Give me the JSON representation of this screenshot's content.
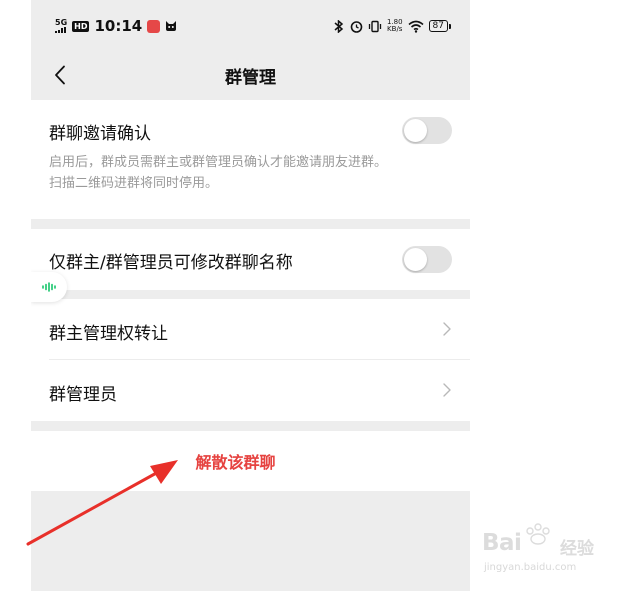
{
  "status_bar": {
    "network": "5G",
    "hd": "HD",
    "time": "10:14",
    "speed_value": "1.80",
    "speed_unit": "KB/s",
    "battery": "87"
  },
  "nav": {
    "title": "群管理"
  },
  "settings": {
    "invite_confirm": {
      "label": "群聊邀请确认",
      "description_line1": "启用后，群成员需群主或群管理员确认才能邀请朋友进群。",
      "description_line2": "扫描二维码进群将同时停用。",
      "enabled": false
    },
    "rename_restriction": {
      "label": "仅群主/群管理员可修改群聊名称",
      "enabled": false
    },
    "transfer_owner": {
      "label": "群主管理权转让"
    },
    "admins": {
      "label": "群管理员"
    },
    "dissolve": {
      "label": "解散该群聊"
    }
  },
  "colors": {
    "danger": "#e64340",
    "toggle_off": "#e2e2e2",
    "background": "#ededed",
    "arrow": "#e8302a"
  },
  "watermark": {
    "brand": "Bai",
    "brand_suffix": "经验",
    "url": "jingyan.baidu.com"
  }
}
